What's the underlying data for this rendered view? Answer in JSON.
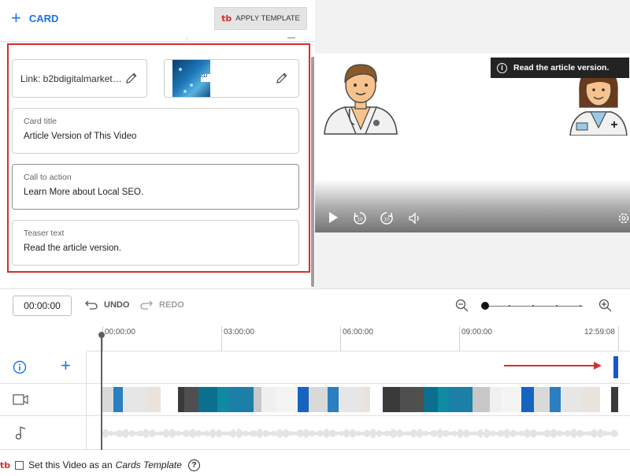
{
  "toolbar": {
    "add_card_label": "CARD",
    "apply_template_label": "APPLY TEMPLATE",
    "logo_text": "tb"
  },
  "card_editor": {
    "link_text": "Link: b2bdigitalmarket…",
    "thumbnail_label": "CLI",
    "card_title": {
      "label": "Card title",
      "value": "Article Version of This Video"
    },
    "call_to_action": {
      "label": "Call to action",
      "value": "Learn More about Local SEO."
    },
    "teaser_text": {
      "label": "Teaser text",
      "value": "Read the article version."
    }
  },
  "preview": {
    "teaser_overlay": "Read the article version.",
    "info_glyph": "i",
    "controls": [
      "play-icon",
      "rewind-10-icon",
      "forward-10-icon",
      "volume-icon",
      "settings-icon"
    ]
  },
  "timeline": {
    "current_time": "00:00:00",
    "undo_label": "UNDO",
    "redo_label": "REDO",
    "ruler": [
      "00:00:00",
      "03:00:00",
      "06:00:00",
      "09:00:00",
      "12:59:08"
    ],
    "tracks": [
      "cards-info-icon",
      "video-icon",
      "audio-icon"
    ],
    "add_card_glyph": "+"
  },
  "footer": {
    "logo_text": "tb",
    "text": "Set this Video as an",
    "italic_text": "Cards Template",
    "help_glyph": "?"
  },
  "colors": {
    "accent_blue": "#1a73e8",
    "highlight_red": "#d32f2f",
    "marker_blue": "#1a56c9"
  }
}
